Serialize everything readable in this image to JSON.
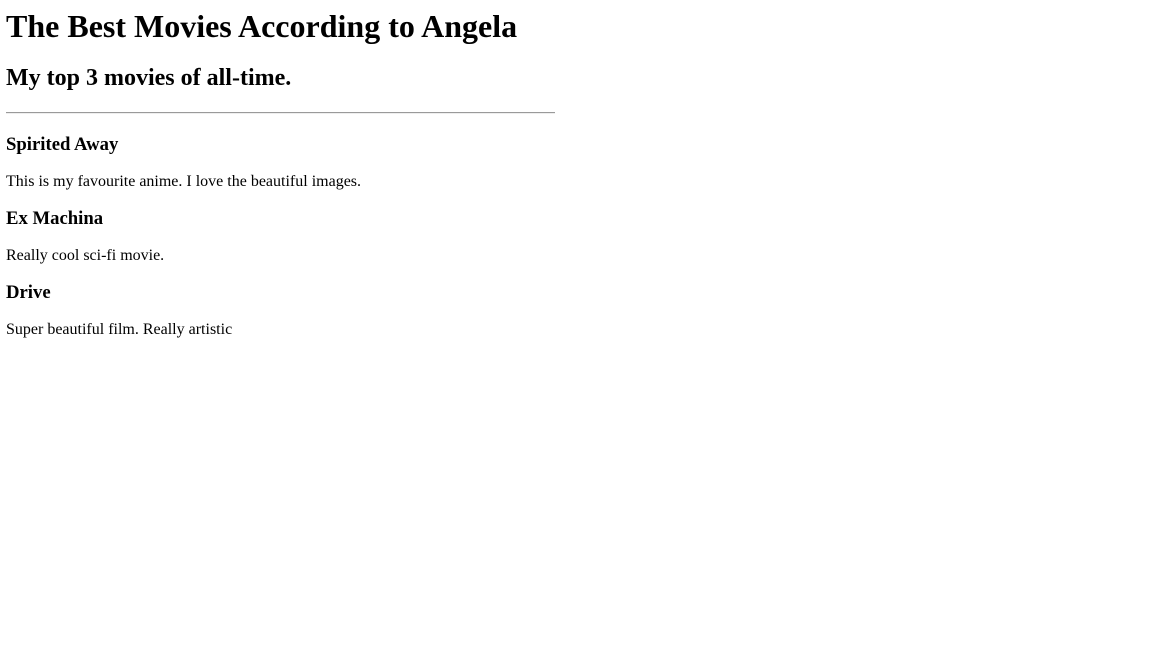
{
  "page": {
    "title": "The Best Movies According to Angela",
    "subtitle": "My top 3 movies of all-time."
  },
  "movies": [
    {
      "title": "Spirited Away",
      "description": "This is my favourite anime. I love the beautiful images."
    },
    {
      "title": "Ex Machina",
      "description": "Really cool sci-fi movie."
    },
    {
      "title": "Drive",
      "description": "Super beautiful film. Really artistic"
    }
  ]
}
